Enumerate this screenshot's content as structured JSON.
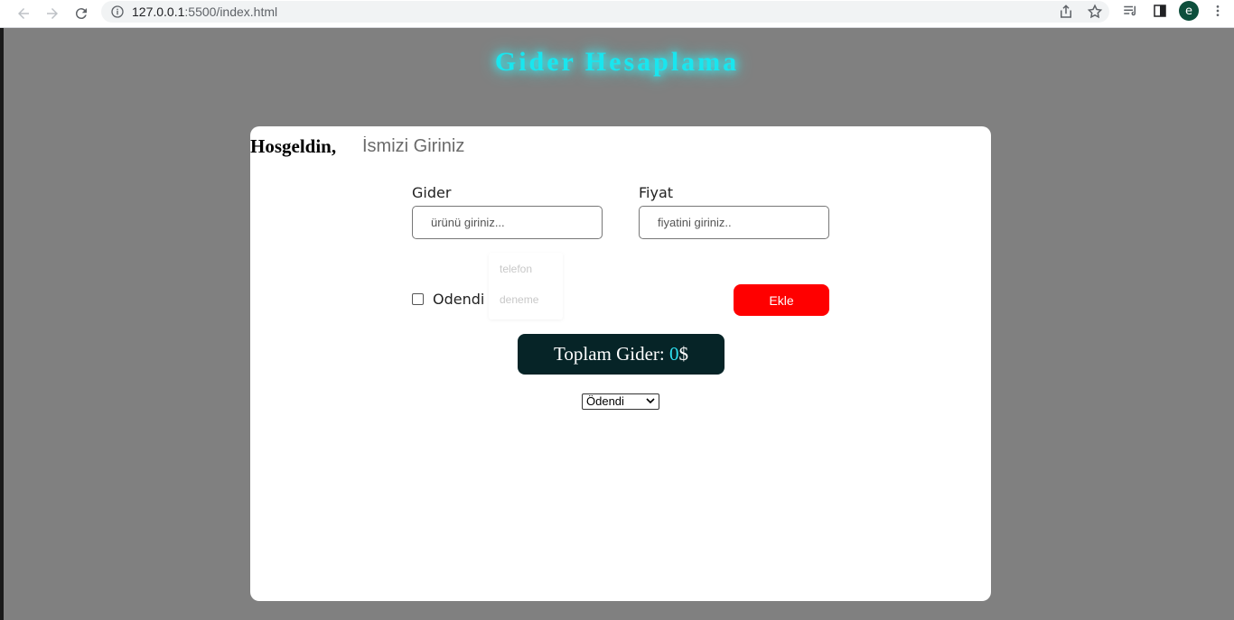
{
  "browser": {
    "url_host": "127.0.0.1",
    "url_rest": ":5500/index.html",
    "profile_initial": "e"
  },
  "page": {
    "title": "Gider Hesaplama",
    "welcome": "Hosgeldin,",
    "name_placeholder": "İsmizi Giriniz"
  },
  "form": {
    "gider_label": "Gider",
    "gider_placeholder": "ürünü giriniz...",
    "fiyat_label": "Fiyat",
    "fiyat_placeholder": "fiyatini giriniz..",
    "suggestions": [
      "telefon",
      "deneme"
    ],
    "paid_label": "Odendi",
    "add_label": "Ekle"
  },
  "total": {
    "label": "Toplam Gider: ",
    "amount": "0",
    "currency": "$"
  },
  "filter": {
    "selected": "Ödendi"
  },
  "colors": {
    "background": "#808080",
    "title": "#19e6ef",
    "add_button": "#ff0000",
    "total_box": "#062427",
    "amount": "#2ee0f0"
  }
}
